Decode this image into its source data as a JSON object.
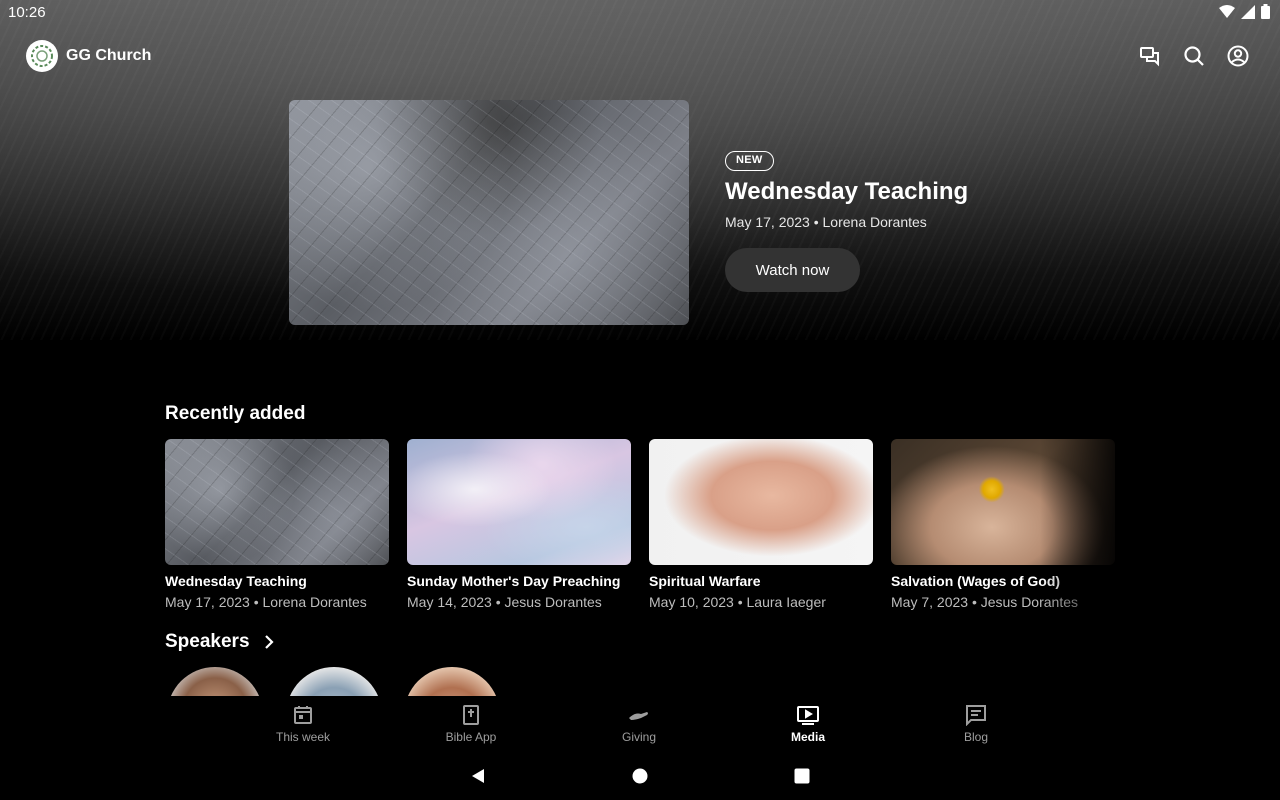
{
  "status_bar": {
    "time": "10:26"
  },
  "app": {
    "name": "GG Church"
  },
  "header_actions": [
    {
      "icon": "chat-icon"
    },
    {
      "icon": "search-icon"
    },
    {
      "icon": "account-icon"
    }
  ],
  "featured": {
    "badge": "NEW",
    "title": "Wednesday Teaching",
    "meta": "May 17, 2023 • Lorena Dorantes",
    "button_label": "Watch now"
  },
  "recently_added": {
    "heading": "Recently added",
    "items": [
      {
        "title": "Wednesday Teaching",
        "meta": "May 17, 2023 • Lorena Dorantes"
      },
      {
        "title": "Sunday Mother's Day Preaching",
        "meta": "May 14, 2023 • Jesus Dorantes"
      },
      {
        "title": "Spiritual Warfare",
        "meta": "May 10, 2023 • Laura Iaeger"
      },
      {
        "title": "Salvation (Wages of God)",
        "meta": "May 7, 2023 • Jesus Dorantes"
      }
    ]
  },
  "speakers": {
    "heading": "Speakers"
  },
  "bottom_nav": {
    "active": "Media",
    "items": [
      {
        "label": "This week",
        "icon": "calendar-icon"
      },
      {
        "label": "Bible App",
        "icon": "bible-icon"
      },
      {
        "label": "Giving",
        "icon": "giving-hand-icon"
      },
      {
        "label": "Media",
        "icon": "media-play-icon"
      },
      {
        "label": "Blog",
        "icon": "blog-icon"
      }
    ]
  },
  "colors": {
    "background": "#000000",
    "accent_text": "#ffffff",
    "muted_text": "#9e9e9e",
    "button_bg": "#333333"
  }
}
